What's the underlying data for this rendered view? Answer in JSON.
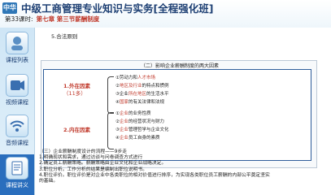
{
  "header": {
    "logo_text": "中华",
    "course_title": "中级工商管理专业知识与实务[全程强化班]",
    "lesson_label": "第33课时:",
    "lesson_name": "第七章 第三节薪酬制度"
  },
  "sidebar": {
    "items": [
      {
        "label": "课程列表",
        "icon": "course-list-icon"
      },
      {
        "label": "视频课程",
        "icon": "video-course-icon"
      },
      {
        "label": "音频课程",
        "icon": "audio-course-icon"
      },
      {
        "label": "课程讲义",
        "icon": "course-handout-icon"
      }
    ]
  },
  "content": {
    "section_heading": "5.合法原则",
    "slide": {
      "title": "（二）影响企业薪酬制度的两大因素",
      "external": {
        "label": "1.外在因素",
        "count": "（11多）",
        "items": [
          {
            "pre": "①劳动力和",
            "hl": "人才市场",
            "post": ""
          },
          {
            "pre": "②",
            "hl": "地区及行业",
            "post": "的特点和惯例"
          },
          {
            "pre": "③企业",
            "hl": "所在地区",
            "post": "的生活水平"
          },
          {
            "pre": "④",
            "hl": "国家",
            "post": "的有关法律和法规"
          }
        ]
      },
      "internal": {
        "label": "2.内在因素",
        "items": [
          {
            "pre": "①",
            "hl": "企业",
            "post": "的业务性质"
          },
          {
            "pre": "②",
            "hl": "企业",
            "post": "的经营状况与财力"
          },
          {
            "pre": "③",
            "hl": "企业",
            "post": "管理哲学与企业文化"
          },
          {
            "pre": "④",
            "hl": "企业",
            "post": "员工自身的素质"
          }
        ]
      }
    },
    "lower_lines": [
      "（三）企业薪酬制度设计的流程——9步走",
      "1.明确现状和需求，通过访谈与问卷调查方式进行",
      "2.确定员工薪酬策略。薪酬策略由企业文化和企业战略决定。",
      "3.职位分析。工作分析的结果是编制出职位说明书。",
      "4.职位评价。职位评价是对企业中各类职位的相对价值进行排序，为实现各类职位员工薪酬的内部公平奠定坚实",
      "的基础。"
    ]
  }
}
